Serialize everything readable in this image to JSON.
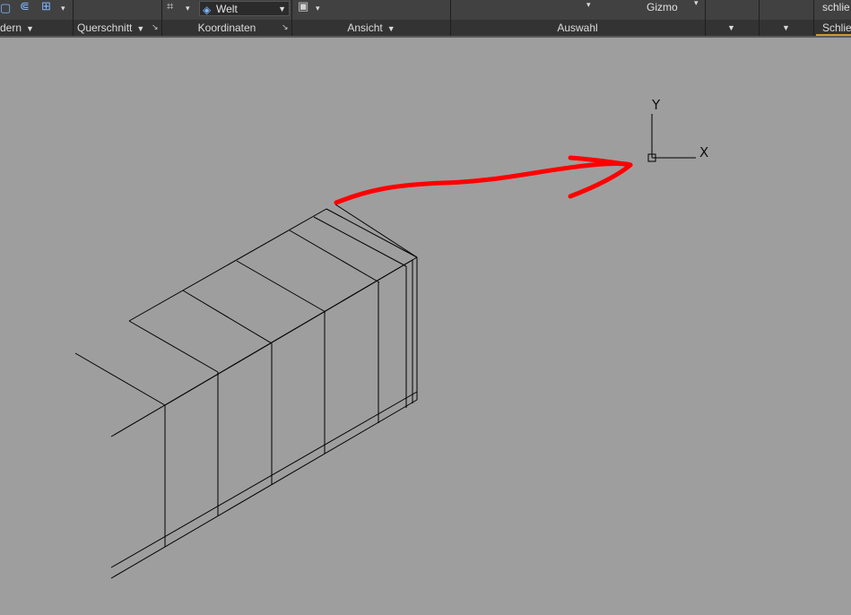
{
  "ribbon": {
    "panels": [
      {
        "id": "aendern",
        "label": "dern",
        "has_dropdown": true
      },
      {
        "id": "querschnitt",
        "label": "Querschnitt",
        "has_dropdown": true,
        "has_launcher": true
      },
      {
        "id": "koordinaten",
        "label": "Koordinaten",
        "has_launcher": true
      },
      {
        "id": "ansicht",
        "label": "Ansicht",
        "has_dropdown": true
      },
      {
        "id": "auswahl",
        "label": "Auswahl"
      },
      {
        "id": "schliessen",
        "label": "Schlie"
      }
    ],
    "ucs_combo": {
      "value": "Welt",
      "icon": "ucs-world-icon"
    },
    "gizmo_label": "Gizmo",
    "schliessen_button": "schlie"
  },
  "viewport": {
    "background": "#9e9e9e",
    "ucs_icon": {
      "x_label": "X",
      "y_label": "Y"
    },
    "annotation_color": "#ff0000"
  }
}
